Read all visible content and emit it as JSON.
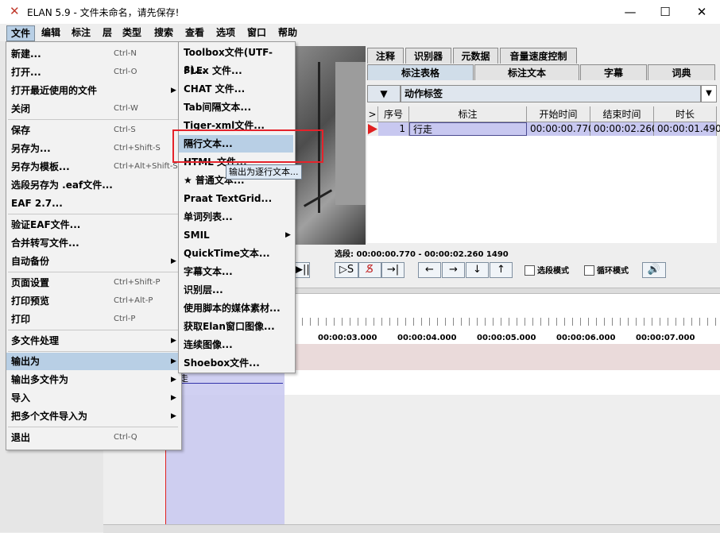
{
  "window": {
    "title": "ELAN 5.9 - 文件未命名，请先保存!",
    "logo": "✕",
    "minimize": "—",
    "maximize": "☐",
    "close": "✕"
  },
  "menubar": [
    "文件",
    "编辑",
    "标注",
    "层",
    "类型",
    "搜索",
    "查看",
    "选项",
    "窗口",
    "帮助"
  ],
  "file_menu": [
    {
      "label": "新建...",
      "shortcut": "Ctrl-N"
    },
    {
      "label": "打开...",
      "shortcut": "Ctrl-O"
    },
    {
      "label": "打开最近使用的文件",
      "submenu": true
    },
    {
      "label": "关闭",
      "shortcut": "Ctrl-W"
    },
    {
      "label": "保存",
      "shortcut": "Ctrl-S"
    },
    {
      "label": "另存为...",
      "shortcut": "Ctrl+Shift-S"
    },
    {
      "label": "另存为模板...",
      "shortcut": "Ctrl+Alt+Shift-S"
    },
    {
      "label": "选段另存为 .eaf文件..."
    },
    {
      "label": "EAF 2.7..."
    },
    {
      "label": "验证EAF文件..."
    },
    {
      "label": "合并转写文件..."
    },
    {
      "label": "自动备份",
      "submenu": true
    },
    {
      "label": "页面设置",
      "shortcut": "Ctrl+Shift-P"
    },
    {
      "label": "打印预览",
      "shortcut": "Ctrl+Alt-P"
    },
    {
      "label": "打印",
      "shortcut": "Ctrl-P"
    },
    {
      "label": "多文件处理",
      "submenu": true
    },
    {
      "label": "输出为",
      "submenu": true,
      "highlighted": true
    },
    {
      "label": "输出多文件为",
      "submenu": true
    },
    {
      "label": "导入",
      "submenu": true
    },
    {
      "label": "把多个文件导入为",
      "submenu": true
    },
    {
      "label": "退出",
      "shortcut": "Ctrl-Q"
    }
  ],
  "export_menu": [
    {
      "label": "Toolbox文件(UTF-8)..."
    },
    {
      "label": "FLEx 文件..."
    },
    {
      "label": "CHAT 文件..."
    },
    {
      "label": "Tab间隔文本..."
    },
    {
      "label": "Tiger-xml文件..."
    },
    {
      "label": "隔行文本...",
      "highlighted": true
    },
    {
      "label": "HTML 文件..."
    },
    {
      "label": "★ 普通文本..."
    },
    {
      "label": "Praat TextGrid..."
    },
    {
      "label": "单词列表..."
    },
    {
      "label": "SMIL",
      "submenu": true
    },
    {
      "label": "QuickTime文本..."
    },
    {
      "label": "字幕文本..."
    },
    {
      "label": "识别层..."
    },
    {
      "label": "使用脚本的媒体素材..."
    },
    {
      "label": "获取Elan窗口图像..."
    },
    {
      "label": "连续图像..."
    },
    {
      "label": "Shoebox文件..."
    }
  ],
  "tooltip": "输出为逐行文本...",
  "tabs_row1": [
    "注释",
    "识别器",
    "元数据",
    "音量速度控制"
  ],
  "tabs_row2": [
    "标注表格",
    "标注文本",
    "字幕",
    "词典"
  ],
  "tier_combo": {
    "arrow": "▼",
    "value": "动作标签"
  },
  "table": {
    "headers": [
      ">",
      "序号",
      "标注",
      "开始时间",
      "结束时间",
      "时长"
    ],
    "rows": [
      {
        "num": "1",
        "annotation": "行走",
        "start": "00:00:00.770",
        "end": "00:00:02.260",
        "duration": "00:00:01.490"
      }
    ]
  },
  "selection": "选段: 00:00:00.770 - 00:00:02.260  1490",
  "controls": {
    "play_sel": "▷S",
    "clear_sel": "S̸",
    "goto_sel": "→|",
    "left": "←",
    "right": "→",
    "down": "↓",
    "up": "↑",
    "sel_mode": "选段模式",
    "loop_mode": "循环模式",
    "volume": "🔊",
    "prev_btn": "▶||"
  },
  "timeline_ticks": [
    "00:00:03.000",
    "00:00:04.000",
    "00:00:05.000",
    "00:00:06.000",
    "00:00:07.000"
  ],
  "timeline_snippet": "走",
  "colors": {
    "accent": "#b8cfe5",
    "highlight_red": "#e5232b",
    "annotation_fill": "#c8c8f0"
  }
}
